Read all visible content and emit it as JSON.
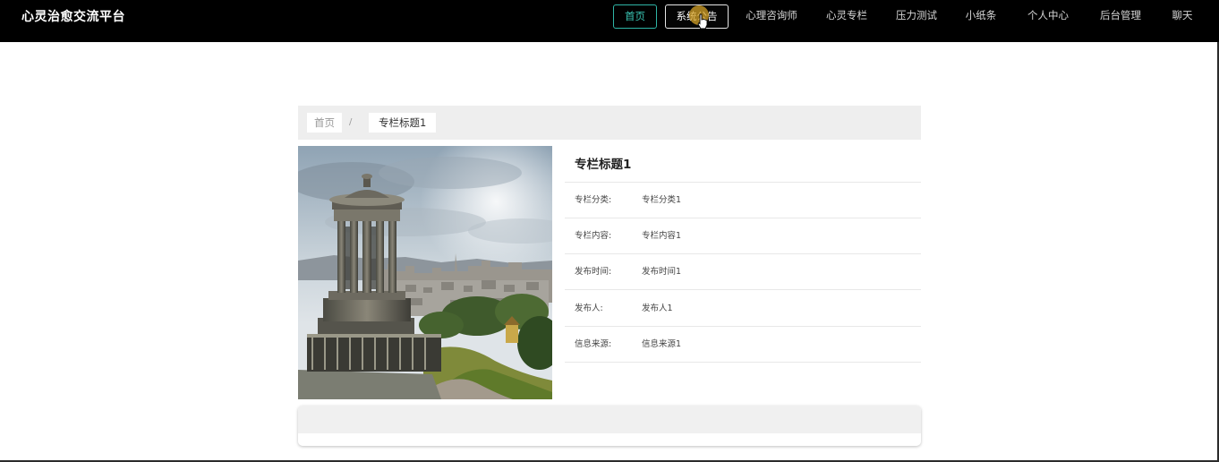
{
  "brand": {
    "title": "心灵治愈交流平台"
  },
  "nav": {
    "home": "首页",
    "announcement": "系统公告",
    "counselors": "心理咨询师",
    "column": "心灵专栏",
    "stress_test": "压力测试",
    "notes": "小纸条",
    "profile": "个人中心",
    "admin": "后台管理",
    "chat": "聊天"
  },
  "breadcrumb": {
    "home": "首页",
    "separator": "/",
    "current": "专栏标题1"
  },
  "detail": {
    "title": "专栏标题1",
    "fields": [
      {
        "label": "专栏分类:",
        "value": "专栏分类1"
      },
      {
        "label": "专栏内容:",
        "value": "专栏内容1"
      },
      {
        "label": "发布时间:",
        "value": "发布时间1"
      },
      {
        "label": "发布人:",
        "value": "发布人1"
      },
      {
        "label": "信息来源:",
        "value": "信息来源1"
      }
    ]
  },
  "colors": {
    "navbar": "#000000",
    "active_accent": "#2fb5a6",
    "breadcrumb_bg": "#eeeeee"
  }
}
